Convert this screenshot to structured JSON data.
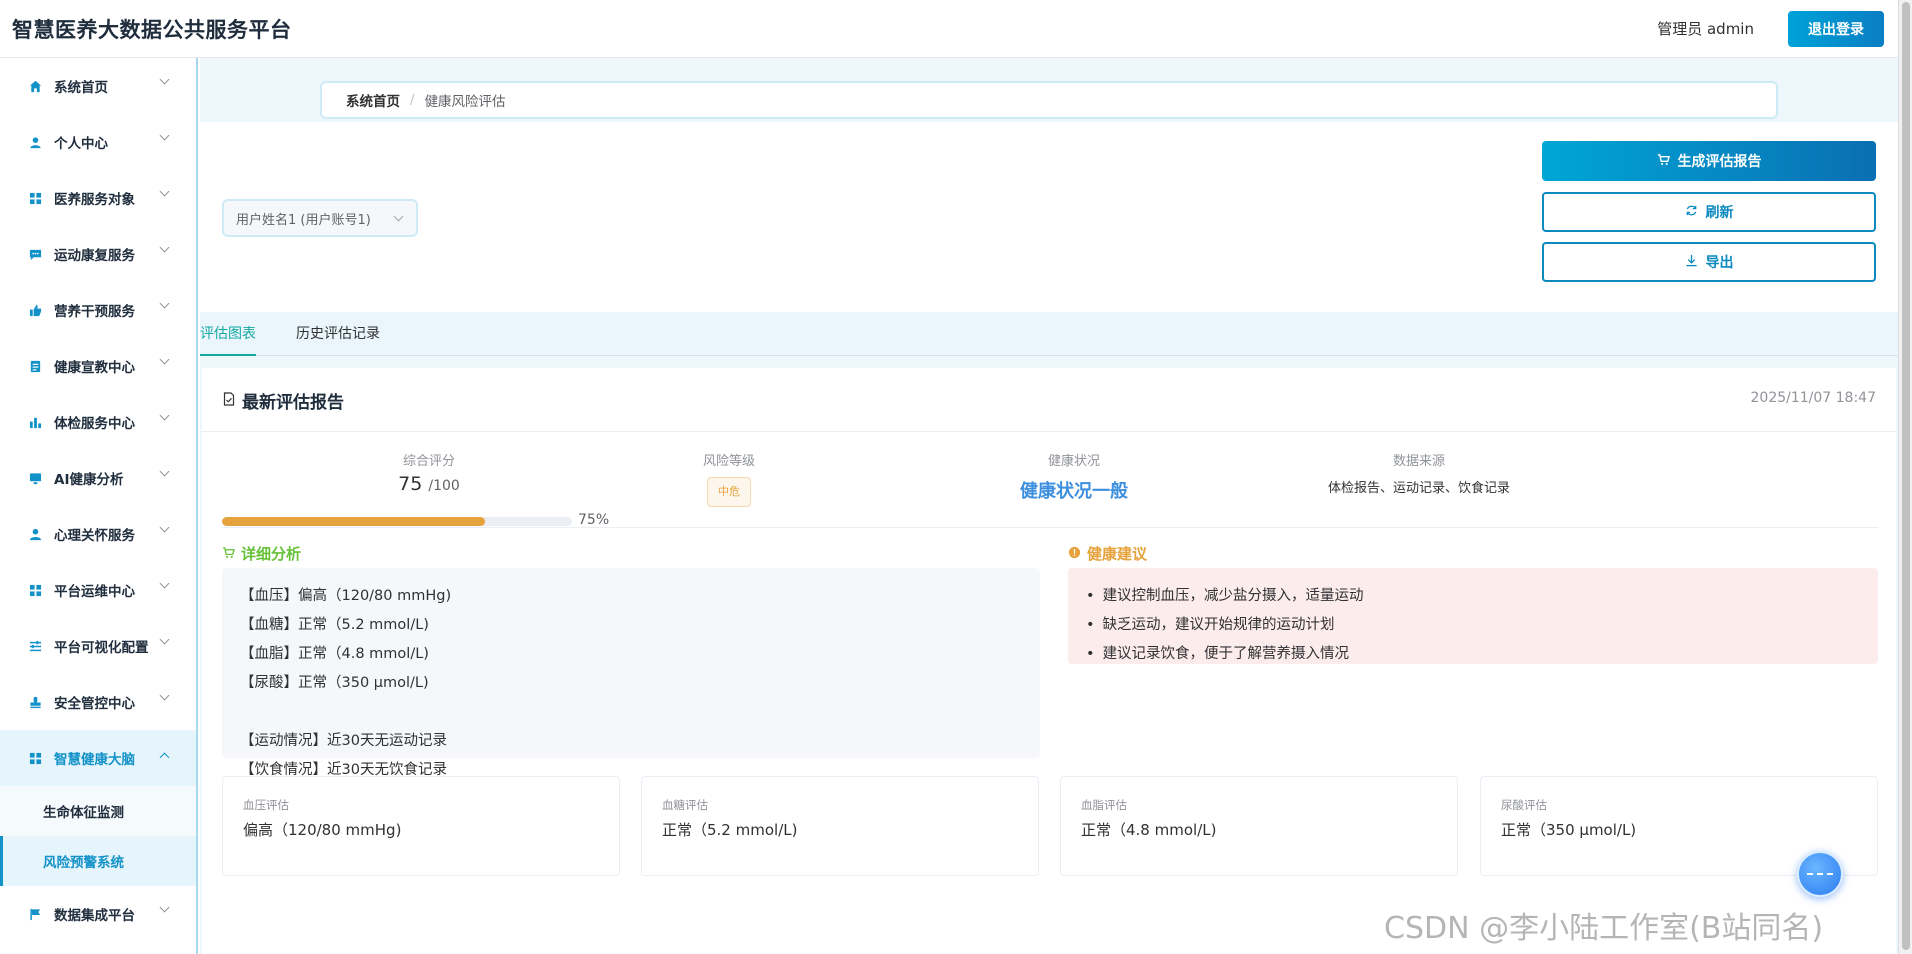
{
  "header": {
    "title": "智慧医养大数据公共服务平台",
    "user": "管理员 admin",
    "logout_label": "退出登录"
  },
  "sidebar": {
    "items": [
      {
        "label": "系统首页",
        "icon": "home-icon"
      },
      {
        "label": "个人中心",
        "icon": "user-icon"
      },
      {
        "label": "医养服务对象",
        "icon": "grid-icon"
      },
      {
        "label": "运动康复服务",
        "icon": "chat-icon"
      },
      {
        "label": "营养干预服务",
        "icon": "thumb-icon"
      },
      {
        "label": "健康宣教中心",
        "icon": "doc-icon"
      },
      {
        "label": "体检服务中心",
        "icon": "bar-chart-icon"
      },
      {
        "label": "AI健康分析",
        "icon": "monitor-icon"
      },
      {
        "label": "心理关怀服务",
        "icon": "person-icon"
      },
      {
        "label": "平台运维中心",
        "icon": "grid-icon"
      },
      {
        "label": "平台可视化配置",
        "icon": "sliders-icon"
      },
      {
        "label": "安全管控中心",
        "icon": "stamp-icon"
      },
      {
        "label": "智慧健康大脑",
        "icon": "grid-icon"
      }
    ],
    "sub_items": [
      "生命体征监测",
      "风险预警系统"
    ],
    "last_item": {
      "label": "数据集成平台",
      "icon": "flag-icon"
    }
  },
  "breadcrumb": {
    "home": "系统首页",
    "sep": "/",
    "current": "健康风险评估"
  },
  "toolbar": {
    "select_value": "用户姓名1 (用户账号1)",
    "generate_label": "生成评估报告",
    "refresh_label": "刷新",
    "export_label": "导出"
  },
  "tabs": [
    "评估图表",
    "历史评估记录"
  ],
  "report": {
    "title": "最新评估报告",
    "time": "2025/11/07 18:47",
    "score_label": "综合评分",
    "score": "75",
    "score_max": "/100",
    "progress_pct": "75%",
    "progress_value": 0.75,
    "risk_label": "风险等级",
    "risk_value": "中危",
    "health_label": "健康状况",
    "health_value": "健康状况一般",
    "source_label": "数据来源",
    "source_value": "体检报告、运动记录、饮食记录",
    "colors": {
      "risk": "#e6a23c",
      "health": "#3d8fe0",
      "analysis": "#67c23a"
    }
  },
  "analysis": {
    "title": "详细分析",
    "lines": [
      "【血压】偏高（120/80 mmHg)",
      "【血糖】正常（5.2 mmol/L)",
      "【血脂】正常（4.8 mmol/L)",
      "【尿酸】正常（350 μmol/L)",
      "【运动情况】近30天无运动记录",
      "【饮食情况】近30天无饮食记录"
    ]
  },
  "advice": {
    "title": "健康建议",
    "items": [
      "建议控制血压，减少盐分摄入，适量运动",
      "缺乏运动，建议开始规律的运动计划",
      "建议记录饮食，便于了解营养摄入情况"
    ]
  },
  "evals": [
    {
      "label": "血压评估",
      "value": "偏高（120/80 mmHg)"
    },
    {
      "label": "血糖评估",
      "value": "正常（5.2 mmol/L)"
    },
    {
      "label": "血脂评估",
      "value": "正常（4.8 mmol/L)"
    },
    {
      "label": "尿酸评估",
      "value": "正常（350 μmol/L)"
    }
  ],
  "watermark": "CSDN @李小陆工作室(B站同名)"
}
